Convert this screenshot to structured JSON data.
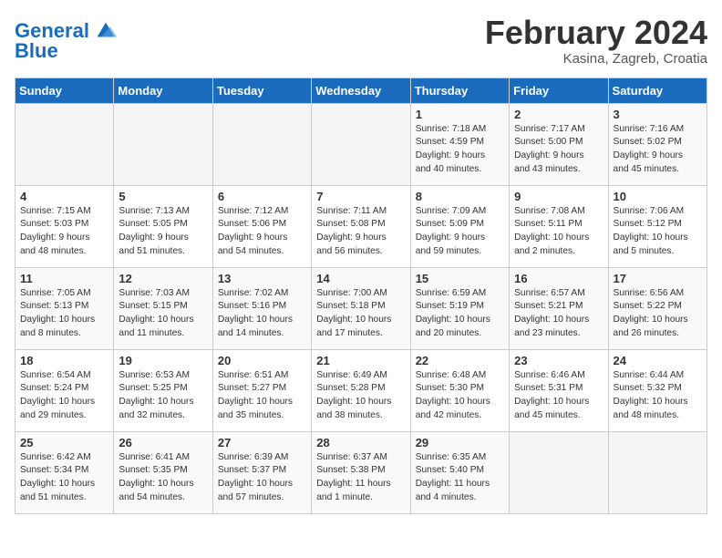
{
  "header": {
    "logo_line1": "General",
    "logo_line2": "Blue",
    "title": "February 2024",
    "location": "Kasina, Zagreb, Croatia"
  },
  "days_of_week": [
    "Sunday",
    "Monday",
    "Tuesday",
    "Wednesday",
    "Thursday",
    "Friday",
    "Saturday"
  ],
  "weeks": [
    [
      {
        "day": "",
        "info": ""
      },
      {
        "day": "",
        "info": ""
      },
      {
        "day": "",
        "info": ""
      },
      {
        "day": "",
        "info": ""
      },
      {
        "day": "1",
        "info": "Sunrise: 7:18 AM\nSunset: 4:59 PM\nDaylight: 9 hours\nand 40 minutes."
      },
      {
        "day": "2",
        "info": "Sunrise: 7:17 AM\nSunset: 5:00 PM\nDaylight: 9 hours\nand 43 minutes."
      },
      {
        "day": "3",
        "info": "Sunrise: 7:16 AM\nSunset: 5:02 PM\nDaylight: 9 hours\nand 45 minutes."
      }
    ],
    [
      {
        "day": "4",
        "info": "Sunrise: 7:15 AM\nSunset: 5:03 PM\nDaylight: 9 hours\nand 48 minutes."
      },
      {
        "day": "5",
        "info": "Sunrise: 7:13 AM\nSunset: 5:05 PM\nDaylight: 9 hours\nand 51 minutes."
      },
      {
        "day": "6",
        "info": "Sunrise: 7:12 AM\nSunset: 5:06 PM\nDaylight: 9 hours\nand 54 minutes."
      },
      {
        "day": "7",
        "info": "Sunrise: 7:11 AM\nSunset: 5:08 PM\nDaylight: 9 hours\nand 56 minutes."
      },
      {
        "day": "8",
        "info": "Sunrise: 7:09 AM\nSunset: 5:09 PM\nDaylight: 9 hours\nand 59 minutes."
      },
      {
        "day": "9",
        "info": "Sunrise: 7:08 AM\nSunset: 5:11 PM\nDaylight: 10 hours\nand 2 minutes."
      },
      {
        "day": "10",
        "info": "Sunrise: 7:06 AM\nSunset: 5:12 PM\nDaylight: 10 hours\nand 5 minutes."
      }
    ],
    [
      {
        "day": "11",
        "info": "Sunrise: 7:05 AM\nSunset: 5:13 PM\nDaylight: 10 hours\nand 8 minutes."
      },
      {
        "day": "12",
        "info": "Sunrise: 7:03 AM\nSunset: 5:15 PM\nDaylight: 10 hours\nand 11 minutes."
      },
      {
        "day": "13",
        "info": "Sunrise: 7:02 AM\nSunset: 5:16 PM\nDaylight: 10 hours\nand 14 minutes."
      },
      {
        "day": "14",
        "info": "Sunrise: 7:00 AM\nSunset: 5:18 PM\nDaylight: 10 hours\nand 17 minutes."
      },
      {
        "day": "15",
        "info": "Sunrise: 6:59 AM\nSunset: 5:19 PM\nDaylight: 10 hours\nand 20 minutes."
      },
      {
        "day": "16",
        "info": "Sunrise: 6:57 AM\nSunset: 5:21 PM\nDaylight: 10 hours\nand 23 minutes."
      },
      {
        "day": "17",
        "info": "Sunrise: 6:56 AM\nSunset: 5:22 PM\nDaylight: 10 hours\nand 26 minutes."
      }
    ],
    [
      {
        "day": "18",
        "info": "Sunrise: 6:54 AM\nSunset: 5:24 PM\nDaylight: 10 hours\nand 29 minutes."
      },
      {
        "day": "19",
        "info": "Sunrise: 6:53 AM\nSunset: 5:25 PM\nDaylight: 10 hours\nand 32 minutes."
      },
      {
        "day": "20",
        "info": "Sunrise: 6:51 AM\nSunset: 5:27 PM\nDaylight: 10 hours\nand 35 minutes."
      },
      {
        "day": "21",
        "info": "Sunrise: 6:49 AM\nSunset: 5:28 PM\nDaylight: 10 hours\nand 38 minutes."
      },
      {
        "day": "22",
        "info": "Sunrise: 6:48 AM\nSunset: 5:30 PM\nDaylight: 10 hours\nand 42 minutes."
      },
      {
        "day": "23",
        "info": "Sunrise: 6:46 AM\nSunset: 5:31 PM\nDaylight: 10 hours\nand 45 minutes."
      },
      {
        "day": "24",
        "info": "Sunrise: 6:44 AM\nSunset: 5:32 PM\nDaylight: 10 hours\nand 48 minutes."
      }
    ],
    [
      {
        "day": "25",
        "info": "Sunrise: 6:42 AM\nSunset: 5:34 PM\nDaylight: 10 hours\nand 51 minutes."
      },
      {
        "day": "26",
        "info": "Sunrise: 6:41 AM\nSunset: 5:35 PM\nDaylight: 10 hours\nand 54 minutes."
      },
      {
        "day": "27",
        "info": "Sunrise: 6:39 AM\nSunset: 5:37 PM\nDaylight: 10 hours\nand 57 minutes."
      },
      {
        "day": "28",
        "info": "Sunrise: 6:37 AM\nSunset: 5:38 PM\nDaylight: 11 hours\nand 1 minute."
      },
      {
        "day": "29",
        "info": "Sunrise: 6:35 AM\nSunset: 5:40 PM\nDaylight: 11 hours\nand 4 minutes."
      },
      {
        "day": "",
        "info": ""
      },
      {
        "day": "",
        "info": ""
      }
    ]
  ]
}
